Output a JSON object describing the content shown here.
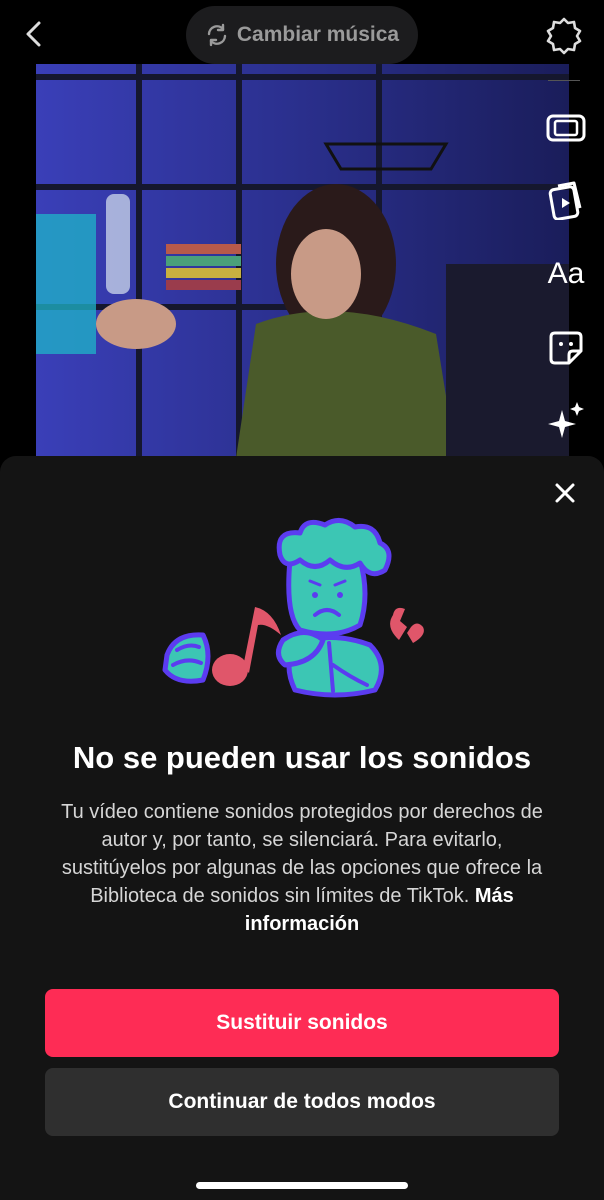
{
  "top_bar": {
    "change_music_label": "Cambiar música"
  },
  "right_toolbar": {
    "text_tool_label": "Aa",
    "tools": [
      "film-icon",
      "clip-icon",
      "text-icon",
      "sticker-icon",
      "effects-sparkle-icon"
    ]
  },
  "sheet": {
    "title": "No se pueden usar los sonidos",
    "description": "Tu vídeo contiene sonidos protegidos por derechos de autor y, por tanto, se silenciará. Para evitarlo, sustitúyelos por algunas de las opciones que ofrece la Biblioteca de sonidos sin límites de TikTok.",
    "more_info_link": "Más información",
    "primary_button": "Sustituir sonidos",
    "secondary_button": "Continuar de todos modos"
  },
  "colors": {
    "accent": "#fe2c55",
    "sheet_bg": "#141414",
    "secondary_button_bg": "#2f2f2f",
    "illustration_teal": "#3cc6b4",
    "illustration_purple": "#5b3cf0",
    "illustration_red": "#e0566a"
  }
}
